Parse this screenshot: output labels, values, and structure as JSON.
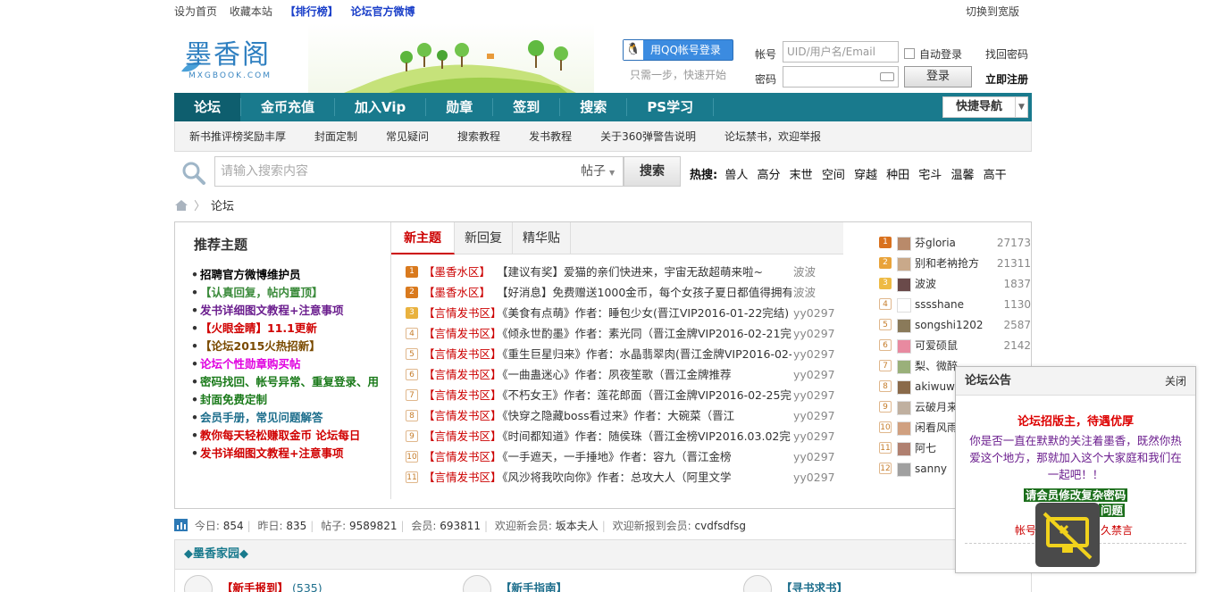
{
  "topbar": {
    "set_home": "设为首页",
    "bookmark": "收藏本站",
    "rank": "【排行榜】",
    "weibo": "论坛官方微博",
    "switch_wide": "切换到宽版"
  },
  "logo": {
    "name": "墨香阁",
    "domain": "MXGBOOK.COM"
  },
  "login": {
    "qq_button": "用QQ帐号登录",
    "qq_tip": "只需一步，快速开始",
    "account_label": "帐号",
    "account_placeholder": "UID/用户名/Email",
    "auto_login": "自动登录",
    "forgot": "找回密码",
    "password_label": "密码",
    "login_button": "登录",
    "register": "立即注册"
  },
  "nav": {
    "items": [
      "论坛",
      "金币充值",
      "加入Vip",
      "勋章",
      "签到",
      "搜索",
      "PS学习"
    ],
    "quick_nav": "快捷导航"
  },
  "subnav": [
    "新书推评榜奖励丰厚",
    "封面定制",
    "常见疑问",
    "搜索教程",
    "发书教程",
    "关于360弹警告说明",
    "论坛禁书，欢迎举报"
  ],
  "search": {
    "placeholder": "请输入搜索内容",
    "type": "帖子",
    "button": "搜索",
    "hot_label": "热搜:",
    "hot": [
      "兽人",
      "高分",
      "末世",
      "空间",
      "穿越",
      "种田",
      "宅斗",
      "温馨",
      "高干"
    ]
  },
  "breadcrumb": {
    "current": "论坛"
  },
  "recommend": {
    "title": "推荐主题",
    "items": [
      {
        "text": "招聘官方微博维护员",
        "color": "#000000"
      },
      {
        "text": "【认真回复，帖内置顶】",
        "color": "#3a8a3a"
      },
      {
        "text": "发书详细图文教程+注意事项",
        "color": "#6b1e8e"
      },
      {
        "text": "【火眼金睛】11.1更新",
        "color": "#d00000"
      },
      {
        "text": "【论坛2015火热招新】",
        "color": "#7a4a00"
      },
      {
        "text": "论坛个性勋章购买帖",
        "color": "#e000e0"
      },
      {
        "text": "密码找回、帐号异常、重复登录、用",
        "color": "#1a7a1a"
      },
      {
        "text": "封面免费定制",
        "color": "#1a7a1a"
      },
      {
        "text": "会员手册，常见问题解答",
        "color": "#1d6e8c"
      },
      {
        "text": "教你每天轻松赚取金币 论坛每日",
        "color": "#d00000"
      },
      {
        "text": "发书详细图文教程+注意事项",
        "color": "#d00000"
      }
    ]
  },
  "tabs": [
    "新主题",
    "新回复",
    "精华贴"
  ],
  "threads": [
    {
      "n": "1",
      "cat": "【墨香水区】",
      "title": "【建议有奖】爱猫的亲们快进来，宇宙无敌超萌来啦~",
      "author": "波波"
    },
    {
      "n": "2",
      "cat": "【墨香水区】",
      "title": "【好消息】免费赠送1000金币，每个女孩子夏日都值得拥有",
      "author": "波波"
    },
    {
      "n": "3",
      "cat": "【言情发书区】",
      "title": "《美食有点萌》作者：睡包少女(晋江VIP2016-01-22完结)",
      "author": "yy0297"
    },
    {
      "n": "4",
      "cat": "【言情发书区】",
      "title": "《倾永世酌墨》作者：素光同（晋江金牌VIP2016-02-21完",
      "author": "yy0297"
    },
    {
      "n": "5",
      "cat": "【言情发书区】",
      "title": "《重生巨星归来》作者：水晶翡翠肉(晋江金牌VIP2016-02-",
      "author": "yy0297"
    },
    {
      "n": "6",
      "cat": "【言情发书区】",
      "title": "《一曲蛊迷心》作者：夙夜笙歌（晋江金牌推荐",
      "author": "yy0297"
    },
    {
      "n": "7",
      "cat": "【言情发书区】",
      "title": "《不朽女王》作者：莲花郎面（晋江金牌VIP2016-02-25完",
      "author": "yy0297"
    },
    {
      "n": "8",
      "cat": "【言情发书区】",
      "title": "《快穿之隐藏boss看过来》作者：大碗菜（晋江",
      "author": "yy0297"
    },
    {
      "n": "9",
      "cat": "【言情发书区】",
      "title": "《时间都知道》作者：随侯珠（晋江金榜VIP2016.03.02完",
      "author": "yy0297"
    },
    {
      "n": "10",
      "cat": "【言情发书区】",
      "title": "《一手遮天，一手捶地》作者：容九（晋江金榜",
      "author": "yy0297"
    },
    {
      "n": "11",
      "cat": "【言情发书区】",
      "title": "《风沙将我吹向你》作者：总攻大人（阿里文学",
      "author": "yy0297"
    }
  ],
  "ranks": [
    {
      "n": "1",
      "name": "芬gloria",
      "count": "27173"
    },
    {
      "n": "2",
      "name": "别和老衲抢方",
      "count": "21311"
    },
    {
      "n": "3",
      "name": "波波",
      "count": "1837"
    },
    {
      "n": "4",
      "name": "sssshane",
      "count": "1130"
    },
    {
      "n": "5",
      "name": "songshi1202",
      "count": "2587"
    },
    {
      "n": "6",
      "name": "可爱硕鼠",
      "count": "2142"
    },
    {
      "n": "7",
      "name": "梨、微醉",
      "count": ""
    },
    {
      "n": "8",
      "name": "akiwuwu",
      "count": ""
    },
    {
      "n": "9",
      "name": "云破月来",
      "count": ""
    },
    {
      "n": "10",
      "name": "闲看风雨",
      "count": ""
    },
    {
      "n": "11",
      "name": "阿七",
      "count": ""
    },
    {
      "n": "12",
      "name": "sanny",
      "count": ""
    }
  ],
  "stats": {
    "today_label": "今日:",
    "today": "854",
    "yesterday_label": "昨日:",
    "yesterday": "835",
    "posts_label": "帖子:",
    "posts": "9589821",
    "members_label": "会员:",
    "members": "693811",
    "welcome_label": "欢迎新会员:",
    "welcome": "坂本夫人",
    "checkin_label": "欢迎新报到会员:",
    "checkin": "cvdfsdfsg"
  },
  "home_section": {
    "title": "◆墨香家园◆",
    "forums": [
      {
        "name": "【新手报到】",
        "count": "(535)"
      },
      {
        "name": "【新手指南】",
        "count": ""
      },
      {
        "name": "【寻书求书】",
        "count": ""
      }
    ]
  },
  "notice": {
    "title": "论坛公告",
    "close": "关闭",
    "headline": "论坛招版主，待遇优厚",
    "body": "你是否一直在默默的关注着墨香，既然你热爱这个地方，那就加入这个大家庭和我们在一起吧！！",
    "highlight": "请会员修改复杂密码",
    "highlight2": "问题",
    "line_left": "帐号",
    "line_right": "久禁言"
  }
}
